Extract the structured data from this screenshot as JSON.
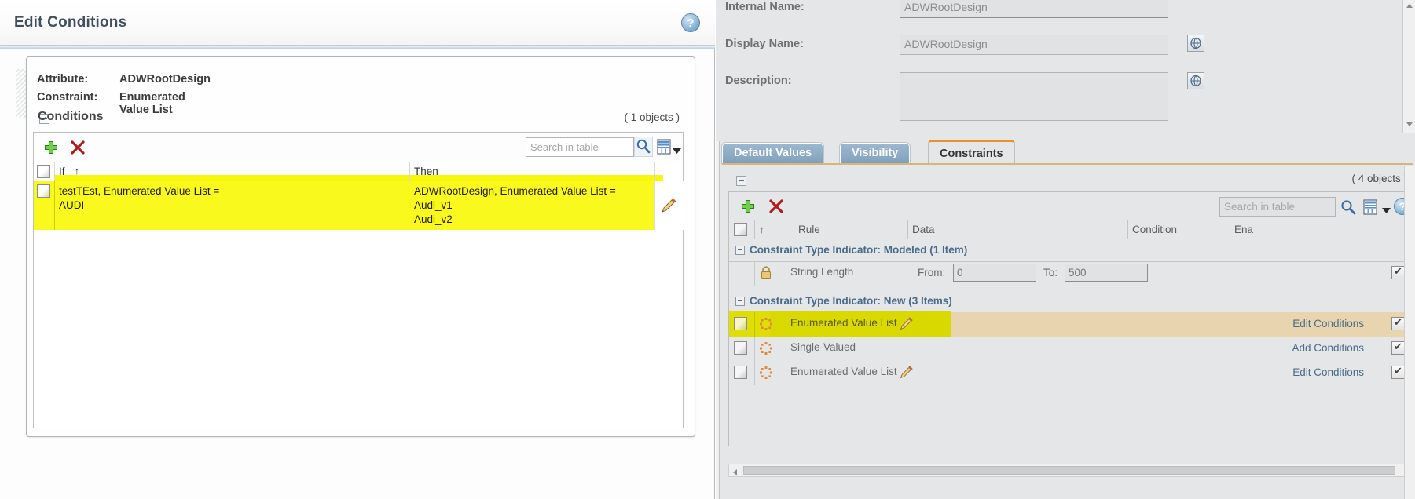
{
  "dialog": {
    "title": "Edit Conditions",
    "help_icon": "help-icon",
    "attribute_label": "Attribute:",
    "attribute_value": "ADWRootDesign",
    "constraint_label": "Constraint:",
    "constraint_value": "Enumerated Value List",
    "section_title": "Conditions",
    "objects_count": "( 1 objects )",
    "toolbar": {
      "add_icon": "add-plus-icon",
      "delete_icon": "delete-x-icon",
      "search_placeholder": "Search in table",
      "search_value": "",
      "search_icon": "search-magnifier-icon",
      "grid_icon": "table-grid-icon",
      "caret_icon": "chevron-down-icon"
    },
    "table": {
      "columns": [
        "If",
        "Then"
      ],
      "sort_indicator": "↑",
      "rows": [
        {
          "if": "testTEst, Enumerated Value List =\n    AUDI",
          "then": "ADWRootDesign, Enumerated Value List =\n    Audi_v1\n    Audi_v2",
          "edit_icon": "pencil-edit-icon"
        }
      ]
    }
  },
  "right": {
    "form": {
      "internal_name_label": "Internal Name:",
      "internal_name_value": "ADWRootDesign",
      "display_name_label": "Display Name:",
      "display_name_value": "ADWRootDesign",
      "description_label": "Description:",
      "description_value": "",
      "display_name_button_icon": "translate-globe-icon",
      "description_button_icon": "translate-globe-icon",
      "scroll_up_icon": "scroll-up-arrow",
      "scroll_down_icon": "scroll-down-arrow"
    },
    "tabs": [
      {
        "label": "Default Values",
        "active": false
      },
      {
        "label": "Visibility",
        "active": false
      },
      {
        "label": "Constraints",
        "active": true
      }
    ],
    "constraints": {
      "objects_count": "( 4 objects )",
      "toolbar": {
        "add_icon": "add-plus-icon",
        "delete_icon": "delete-x-icon",
        "search_placeholder": "Search in table",
        "search_value": "",
        "search_icon": "search-magnifier-icon",
        "grid_icon": "table-grid-icon",
        "caret_icon": "chevron-down-icon",
        "help_icon": "help-circle-icon"
      },
      "columns": [
        "",
        "↑",
        "Rule",
        "Data",
        "Condition",
        "Ena"
      ],
      "groups": [
        {
          "label": "Constraint Type Indicator: Modeled (1 Item)",
          "rows": [
            {
              "icon": "lock-icon",
              "rule": "String Length",
              "from_label": "From:",
              "from_value": "0",
              "to_label": "To:",
              "to_value": "500",
              "condition": "",
              "enabled": true,
              "highlight": "none"
            }
          ]
        },
        {
          "label": "Constraint Type Indicator: New (3 Items)",
          "rows": [
            {
              "icon": "new-constraint-icon",
              "rule": "Enumerated Value List",
              "edit_icon": "pencil-edit-icon",
              "condition": "Edit Conditions",
              "enabled": true,
              "highlight": "selected"
            },
            {
              "icon": "new-constraint-icon",
              "rule": "Single-Valued",
              "condition": "Add Conditions",
              "enabled": true,
              "highlight": "none"
            },
            {
              "icon": "new-constraint-icon",
              "rule": "Enumerated Value List",
              "edit_icon": "pencil-edit-icon",
              "condition": "Edit Conditions",
              "enabled": true,
              "highlight": "none"
            }
          ]
        }
      ],
      "hscroll_left_icon": "scroll-left-arrow"
    }
  },
  "colors": {
    "highlight_yellow": "#f9f91d",
    "selected_row": "#dede00",
    "selected_band": "#e8d5b0",
    "group_header_text": "#4a6b8a",
    "tab_accent": "#e8922e"
  }
}
